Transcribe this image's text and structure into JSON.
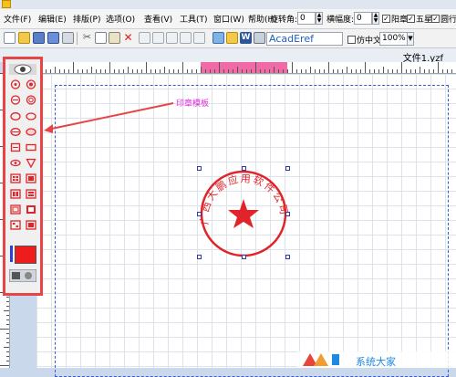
{
  "menu": [
    "文件(F)",
    "编辑(E)",
    "排版(P)",
    "选项(O)",
    "查看(V)",
    "工具(T)",
    "窗口(W)",
    "帮助(H)"
  ],
  "controls": {
    "rotate_label": "旋转角:",
    "rotate_value": "0",
    "stretch_label": "横幅度:",
    "stretch_value": "0",
    "check_yang": "阳章",
    "check_star": "五星",
    "check_outer": "圆行",
    "font_value": "AcadEref",
    "check_fake": "仿中文",
    "zoom_value": "100%"
  },
  "document_tab": "文件1.yzf",
  "callout_label": "印章模板",
  "stamp": {
    "text": "广西大鹏应用软件公司",
    "color": "#e0242a"
  },
  "watermark_text": "系统大家",
  "colors": {
    "accent_red": "#e74545",
    "stamp_red": "#e0242a",
    "selection_blue": "#2f3ca8",
    "callout_magenta": "#e02be0"
  }
}
